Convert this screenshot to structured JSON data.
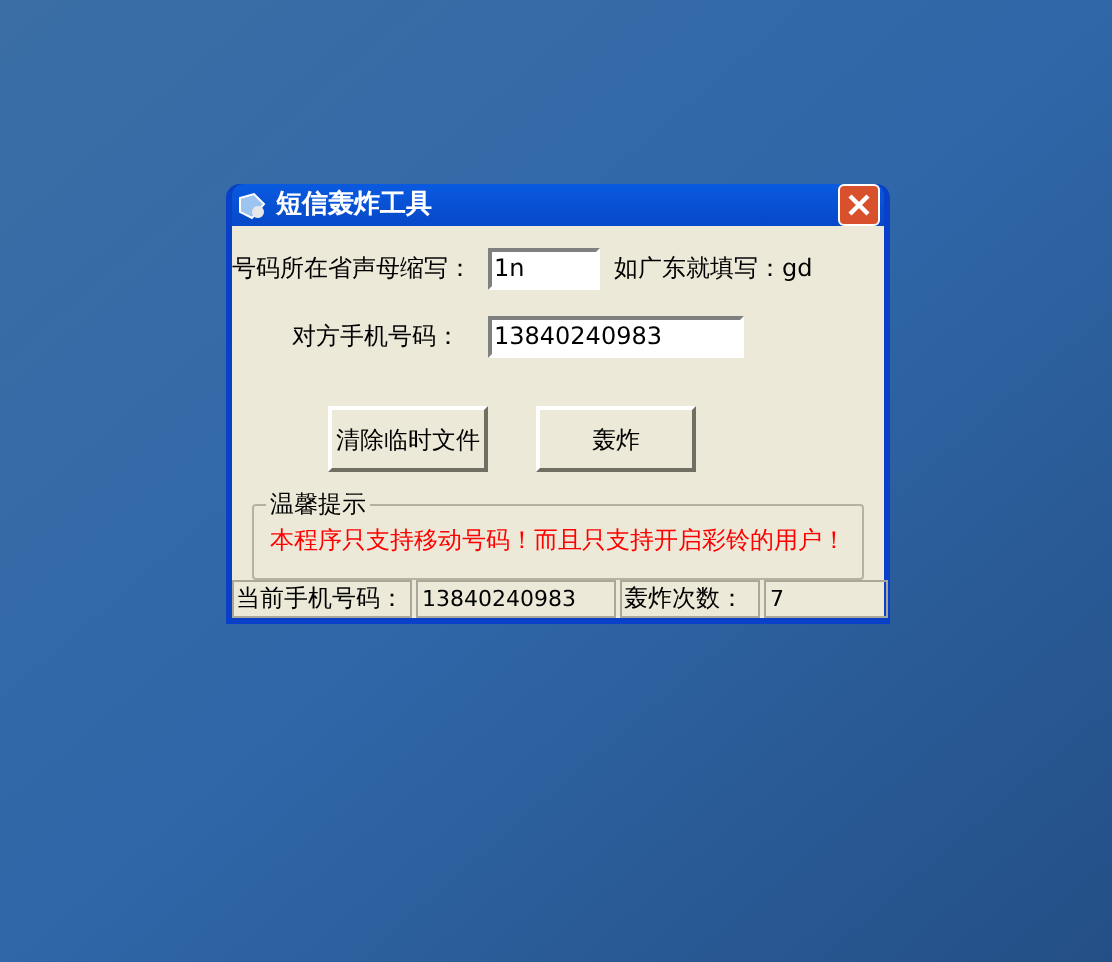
{
  "window": {
    "title": "短信轰炸工具"
  },
  "fields": [
    {
      "label": "号码所在省声母缩写：",
      "value": "1n",
      "hint": "如广东就填写：gd"
    },
    {
      "label": "对方手机号码：",
      "value": "13840240983"
    }
  ],
  "buttons": [
    "清除临时文件",
    "轰炸"
  ],
  "notice": {
    "title": "温馨提示",
    "text": "本程序只支持移动号码！而且只支持开启彩铃的用户！"
  },
  "status_bar": [
    {
      "label": "当前手机号码：",
      "value": "13840240983"
    },
    {
      "label": "轰炸次数：",
      "value": "7"
    }
  ]
}
